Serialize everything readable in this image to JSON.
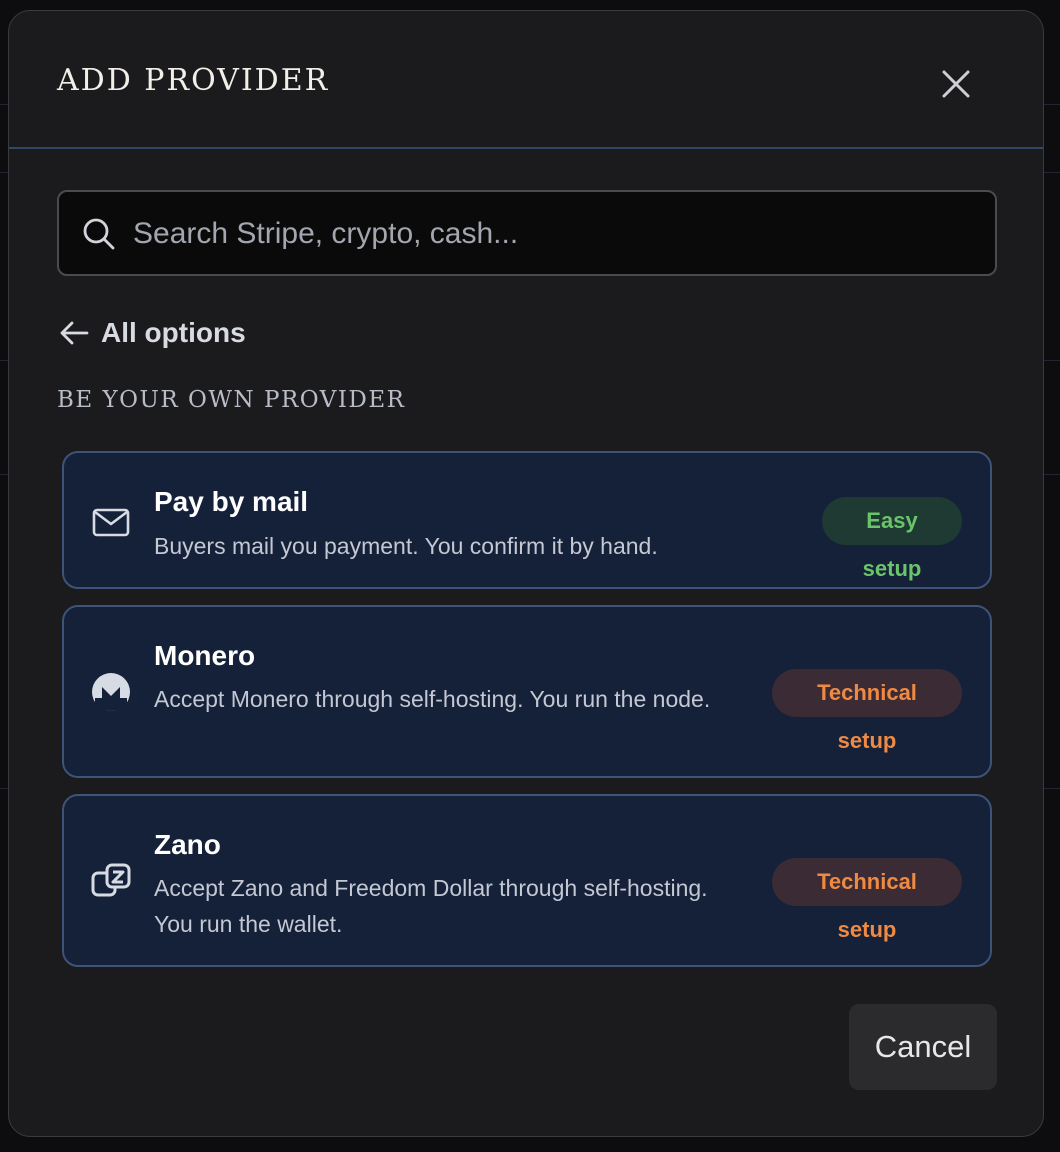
{
  "modal": {
    "title": "ADD PROVIDER",
    "close_icon": "close-icon"
  },
  "search": {
    "icon": "search-icon",
    "placeholder": "Search Stripe, crypto, cash..."
  },
  "back": {
    "icon": "arrow-left-icon",
    "label": "All options"
  },
  "section": {
    "heading": "BE YOUR OWN PROVIDER"
  },
  "providers": [
    {
      "icon": "mail-icon",
      "title": "Pay by mail",
      "description": "Buyers mail you payment. You confirm it by hand.",
      "badge": "Easy setup",
      "badge_color": "#6ac46a"
    },
    {
      "icon": "monero-icon",
      "title": "Monero",
      "description": "Accept Monero through self-hosting. You run the node.",
      "badge": "Technical setup",
      "badge_color": "#ee8a43"
    },
    {
      "icon": "zano-icon",
      "title": "Zano",
      "description": "Accept Zano and Freedom Dollar through self-hosting. You run the wallet.",
      "badge": "Technical setup",
      "badge_color": "#ee8a43"
    }
  ],
  "footer": {
    "cancel_label": "Cancel"
  },
  "colors": {
    "modal_bg": "#1b1b1e",
    "card_bg": "#152039",
    "card_border": "#3d5378",
    "header_divider": "#2f4866"
  }
}
